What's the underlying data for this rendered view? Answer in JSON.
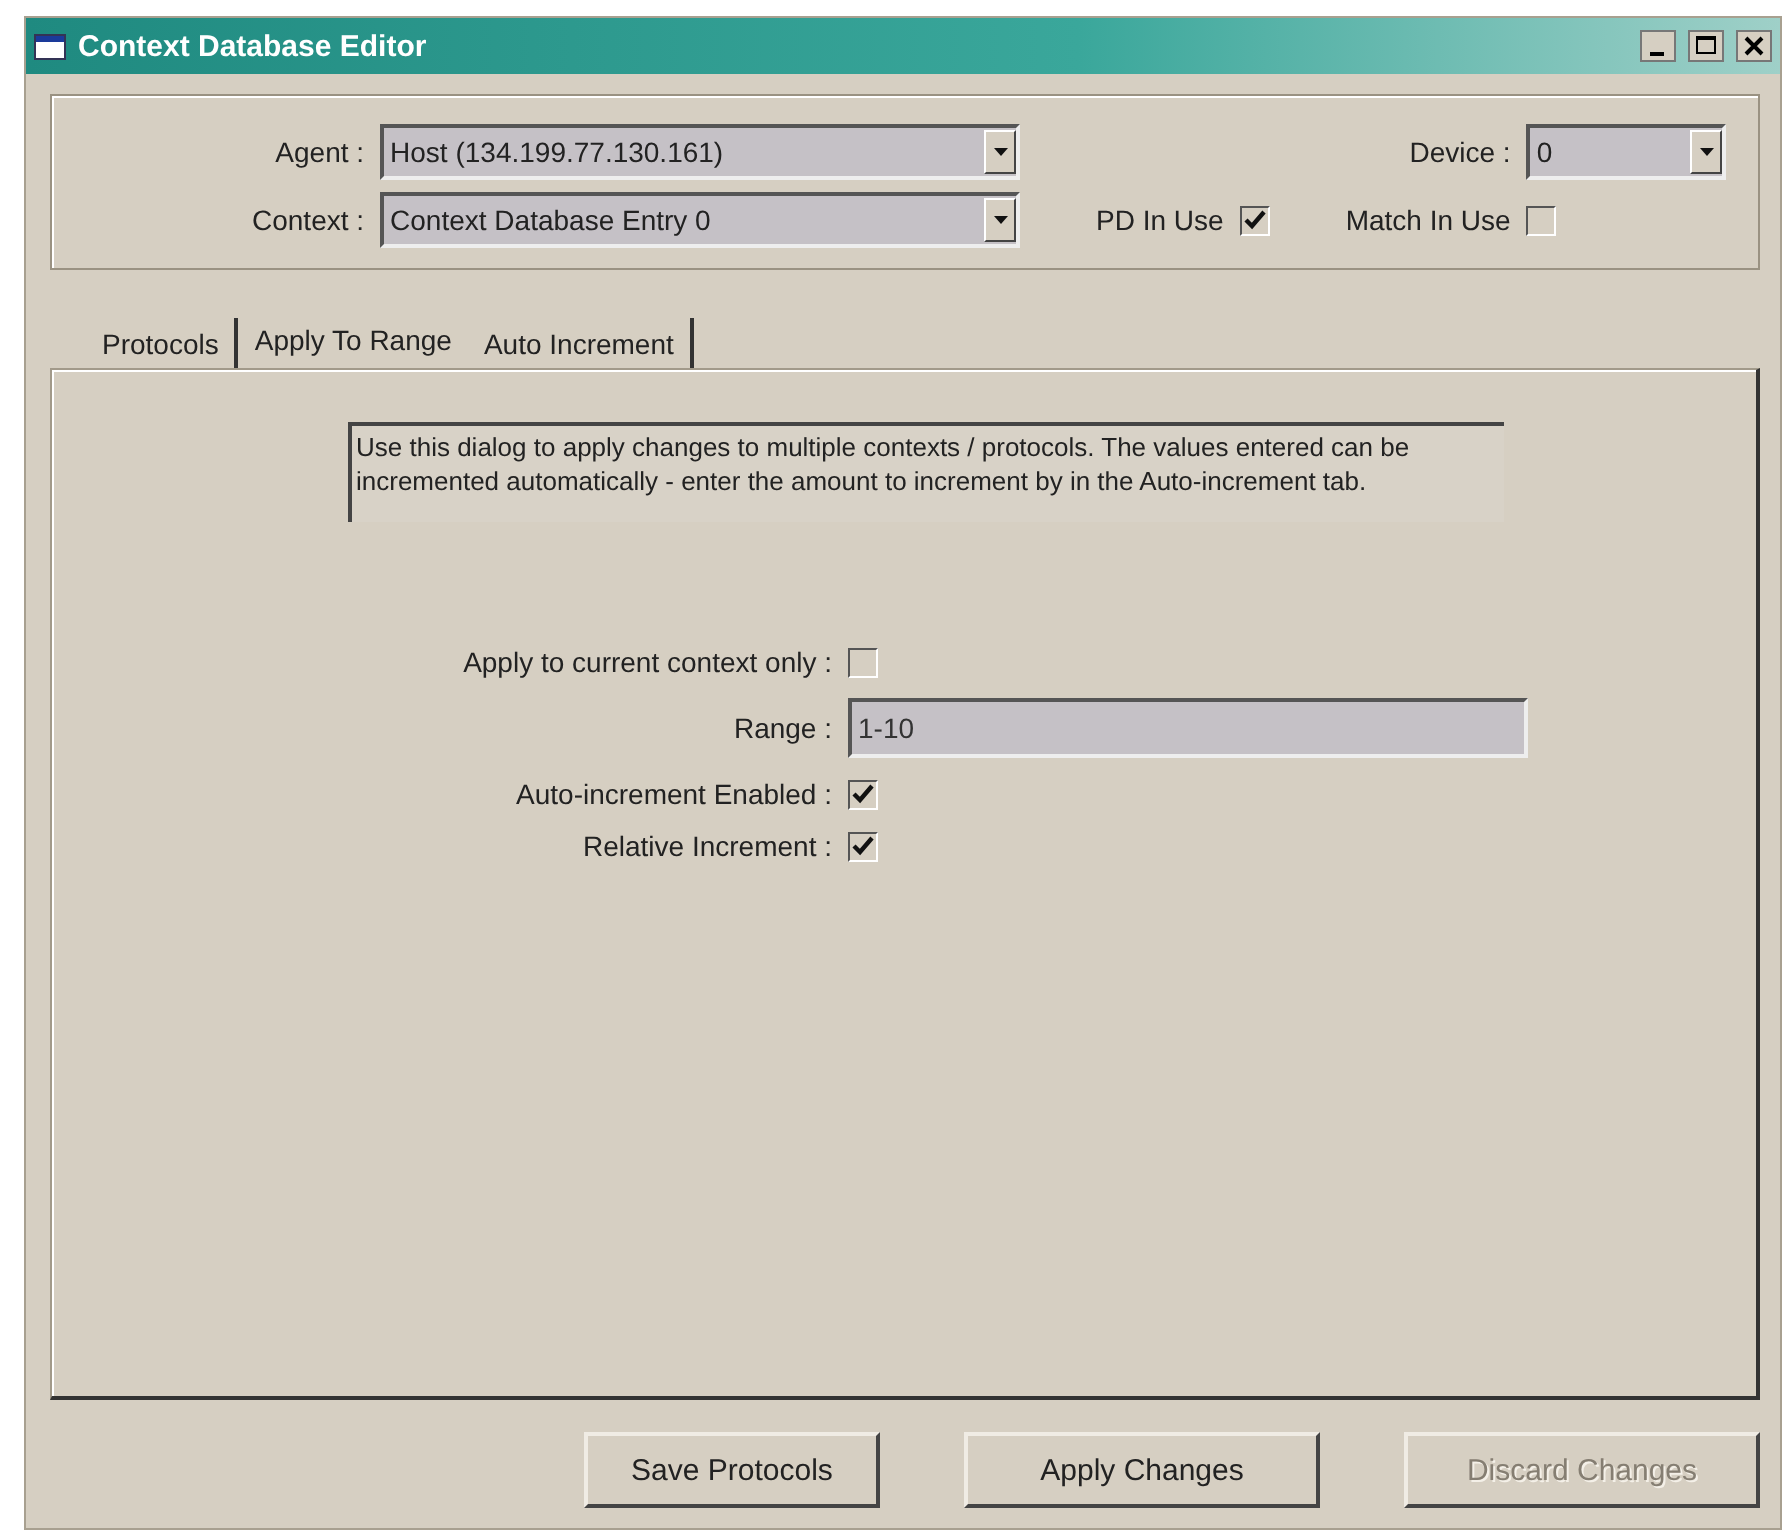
{
  "window": {
    "title": "Context Database Editor"
  },
  "header": {
    "agent": {
      "label": "Agent :",
      "value": "Host (134.199.77.130.161)"
    },
    "context": {
      "label": "Context :",
      "value": "Context Database Entry 0"
    },
    "device": {
      "label": "Device :",
      "value": "0"
    },
    "pd_in_use": {
      "label": "PD In Use",
      "checked": true
    },
    "match_in_use": {
      "label": "Match In Use",
      "checked": false
    }
  },
  "tabs": [
    {
      "label": "Protocols",
      "selected": false
    },
    {
      "label": "Apply To Range",
      "selected": true
    },
    {
      "label": "Auto Increment",
      "selected": false
    }
  ],
  "description": "Use this dialog to apply changes to multiple contexts / protocols.  The values entered can be incremented automatically - enter the amount to increment by in the Auto-increment tab.",
  "fields": [
    {
      "kind": "checkbox",
      "label": "Apply to current context only :",
      "checked": false
    },
    {
      "kind": "text",
      "label": "Range :",
      "value": "1-10"
    },
    {
      "kind": "checkbox",
      "label": "Auto-increment Enabled :",
      "checked": true
    },
    {
      "kind": "checkbox",
      "label": "Relative Increment :",
      "checked": true
    }
  ],
  "buttons": [
    {
      "label": "Save Protocols",
      "disabled": false
    },
    {
      "label": "Apply Changes",
      "disabled": false
    },
    {
      "label": "Discard Changes",
      "disabled": true
    }
  ]
}
